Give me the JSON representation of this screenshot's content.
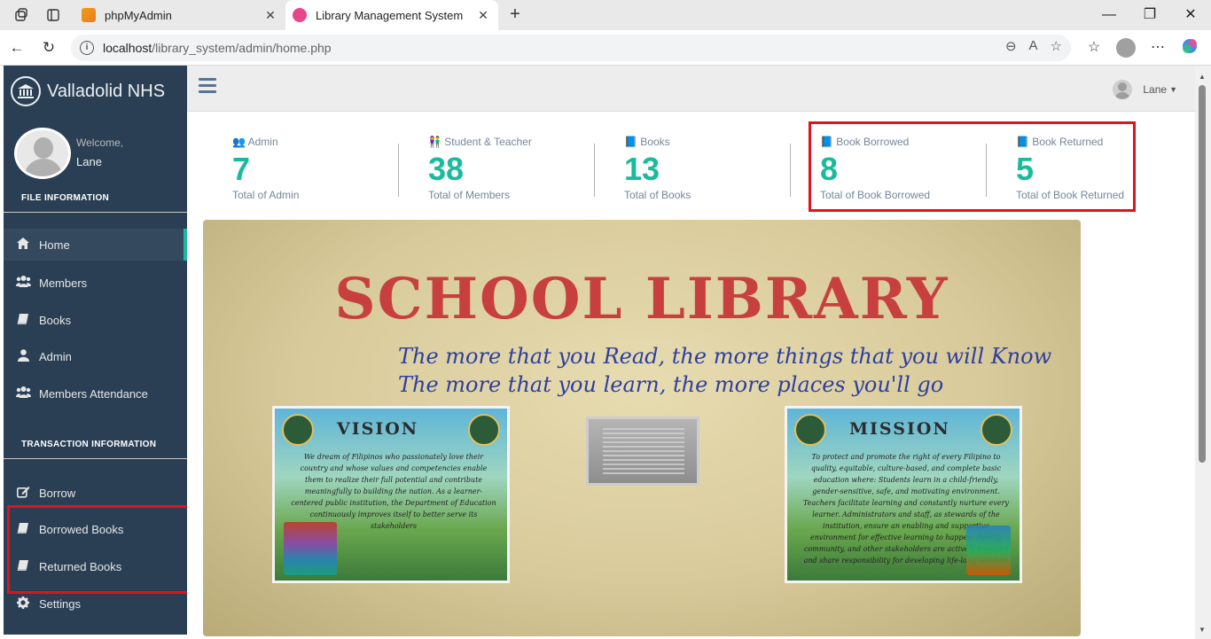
{
  "browser": {
    "tabs": [
      {
        "label": "phpMyAdmin",
        "active": false
      },
      {
        "label": "Library Management System",
        "active": true
      }
    ],
    "url_host": "localhost",
    "url_path": "/library_system/admin/home.php",
    "profile_label": "Lane"
  },
  "sidebar": {
    "brand": "Valladolid NHS",
    "welcome": "Welcome,",
    "username": "Lane",
    "section_file": "FILE INFORMATION",
    "file_items": [
      {
        "label": "Home",
        "icon": "home-icon",
        "active": true
      },
      {
        "label": "Members",
        "icon": "users-icon",
        "active": false
      },
      {
        "label": "Books",
        "icon": "book-icon",
        "active": false
      },
      {
        "label": "Admin",
        "icon": "user-icon",
        "active": false
      },
      {
        "label": "Members Attendance",
        "icon": "users-icon",
        "active": false
      }
    ],
    "section_transaction": "TRANSACTION INFORMATION",
    "transaction_items": [
      {
        "label": "Borrow",
        "icon": "edit-icon"
      },
      {
        "label": "Borrowed Books",
        "icon": "book-icon"
      },
      {
        "label": "Returned Books",
        "icon": "book-icon"
      },
      {
        "label": "Settings",
        "icon": "gear-icon"
      }
    ]
  },
  "topnav": {
    "user": "Lane"
  },
  "tiles": [
    {
      "head": "Admin",
      "icon": "users-icon",
      "count": "7",
      "foot": "Total of Admin"
    },
    {
      "head": "Student & Teacher",
      "icon": "people-icon",
      "count": "38",
      "foot": "Total of Members"
    },
    {
      "head": "Books",
      "icon": "book-icon",
      "count": "13",
      "foot": "Total of Books"
    },
    {
      "head": "Book Borrowed",
      "icon": "book-icon",
      "count": "8",
      "foot": "Total of Book Borrowed"
    },
    {
      "head": "Book Returned",
      "icon": "book-icon",
      "count": "5",
      "foot": "Total of Book Returned"
    }
  ],
  "banner": {
    "title": "SCHOOL LIBRARY",
    "quote_line1": "The more that you Read, the more things that you will Know",
    "quote_line2": "The more that you learn, the more places you'll go",
    "vision_title": "VISION",
    "vision_text": "We dream of Filipinos who passionately love their country and whose values and competencies enable them to realize their full potential and contribute meaningfully to building the nation. As a learner-centered public institution, the Department of Education continuously improves itself to better serve its stakeholders",
    "mission_title": "MISSION",
    "mission_text": "To protect and promote the right of every Filipino to quality, equitable, culture-based, and complete basic education where: Students learn in a child-friendly, gender-sensitive, safe, and motivating environment. Teachers facilitate learning and constantly nurture every learner. Administrators and staff, as stewards of the institution, ensure an enabling and supportive environment for effective learning to happen. Family, community, and other stakeholders are actively engaged and share responsibility for developing life-long learners"
  },
  "colors": {
    "sidebar_bg": "#2a3f54",
    "accent": "#1ABB9C",
    "highlight": "#e0131d"
  }
}
